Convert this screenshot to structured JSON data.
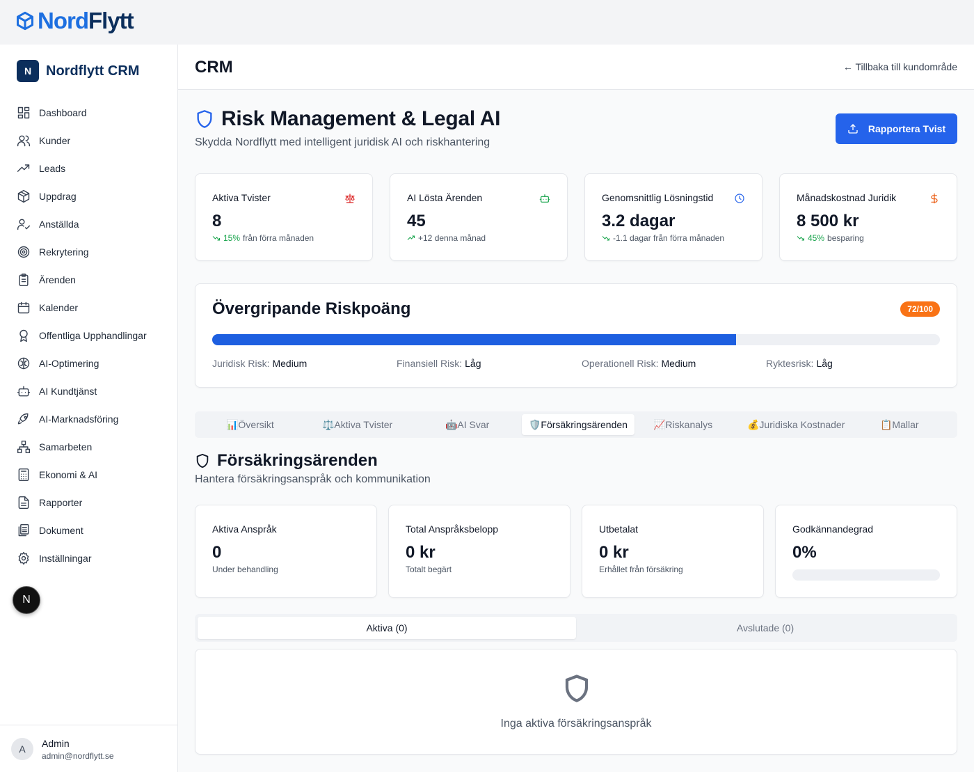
{
  "logo": {
    "part1": "Nord",
    "part2": "Flytt"
  },
  "sidebar": {
    "brand_initial": "N",
    "brand_name": "Nordflytt CRM",
    "items": [
      {
        "label": "Dashboard",
        "icon": "dashboard-icon"
      },
      {
        "label": "Kunder",
        "icon": "users-icon"
      },
      {
        "label": "Leads",
        "icon": "trending-up-icon"
      },
      {
        "label": "Uppdrag",
        "icon": "package-icon"
      },
      {
        "label": "Anställda",
        "icon": "user-check-icon"
      },
      {
        "label": "Rekrytering",
        "icon": "target-icon"
      },
      {
        "label": "Ärenden",
        "icon": "clipboard-icon"
      },
      {
        "label": "Kalender",
        "icon": "calendar-icon"
      },
      {
        "label": "Offentliga Upphandlingar",
        "icon": "award-icon"
      },
      {
        "label": "AI-Optimering",
        "icon": "brain-icon"
      },
      {
        "label": "AI Kundtjänst",
        "icon": "bot-icon"
      },
      {
        "label": "AI-Marknadsföring",
        "icon": "rocket-icon"
      },
      {
        "label": "Samarbeten",
        "icon": "network-icon"
      },
      {
        "label": "Ekonomi & AI",
        "icon": "calculator-icon"
      },
      {
        "label": "Rapporter",
        "icon": "file-text-icon"
      },
      {
        "label": "Dokument",
        "icon": "files-icon"
      },
      {
        "label": "Inställningar",
        "icon": "settings-icon"
      }
    ],
    "next_badge": "N",
    "user": {
      "initial": "A",
      "name": "Admin",
      "email": "admin@nordflytt.se"
    }
  },
  "header": {
    "title": "CRM",
    "back_link": "← Tillbaka till kundområde"
  },
  "page": {
    "title": "Risk Management & Legal AI",
    "subtitle": "Skydda Nordflytt med intelligent juridisk AI och riskhantering",
    "report_button": "Rapportera Tvist"
  },
  "stats": [
    {
      "title": "Aktiva Tvister",
      "value": "8",
      "highlight": "15%",
      "rest": "från förra månaden",
      "icon": "scale-icon",
      "icon_color": "#dc2626"
    },
    {
      "title": "AI Lösta Ärenden",
      "value": "45",
      "highlight": "",
      "rest": "+12 denna månad",
      "icon": "bot-icon",
      "icon_color": "#16a34a"
    },
    {
      "title": "Genomsnittlig Lösningstid",
      "value": "3.2 dagar",
      "highlight": "",
      "rest": "-1.1 dagar från förra månaden",
      "icon": "clock-icon",
      "icon_color": "#2563eb"
    },
    {
      "title": "Månadskostnad Juridik",
      "value": "8 500 kr",
      "highlight": "45%",
      "rest": "besparing",
      "icon": "dollar-icon",
      "icon_color": "#ea580c"
    }
  ],
  "risk": {
    "title": "Övergripande Riskpoäng",
    "badge": "72/100",
    "score": 0.72,
    "categories": [
      {
        "label": "Juridisk Risk:",
        "value": "Medium"
      },
      {
        "label": "Finansiell Risk:",
        "value": "Låg"
      },
      {
        "label": "Operationell Risk:",
        "value": "Medium"
      },
      {
        "label": "Ryktesrisk:",
        "value": "Låg"
      }
    ]
  },
  "tabs": [
    {
      "label": "📊Översikt"
    },
    {
      "label": "⚖️Aktiva Tvister"
    },
    {
      "label": "🤖AI Svar"
    },
    {
      "label": "🛡️Försäkringsärenden",
      "active": true
    },
    {
      "label": "📈Riskanalys"
    },
    {
      "label": "💰Juridiska Kostnader"
    },
    {
      "label": "📋Mallar"
    }
  ],
  "section": {
    "title": "Försäkringsärenden",
    "subtitle": "Hantera försäkringsanspråk och kommunikation"
  },
  "claims": [
    {
      "title": "Aktiva Anspråk",
      "value": "0",
      "sub": "Under behandling"
    },
    {
      "title": "Total Anspråksbelopp",
      "value": "0 kr",
      "sub": "Totalt begärt"
    },
    {
      "title": "Utbetalat",
      "value": "0 kr",
      "sub": "Erhållet från försäkring"
    },
    {
      "title": "Godkännandegrad",
      "value": "0%",
      "progress": 0
    }
  ],
  "subtabs": [
    {
      "label": "Aktiva (0)",
      "active": true
    },
    {
      "label": "Avslutade (0)"
    }
  ],
  "empty": {
    "text": "Inga aktiva försäkringsanspråk",
    "icon": "shield-icon"
  },
  "colors": {
    "primary": "#2563eb",
    "brand_dark": "#0b2e5c",
    "risk_badge": "#f97316",
    "positive": "#16a34a"
  }
}
